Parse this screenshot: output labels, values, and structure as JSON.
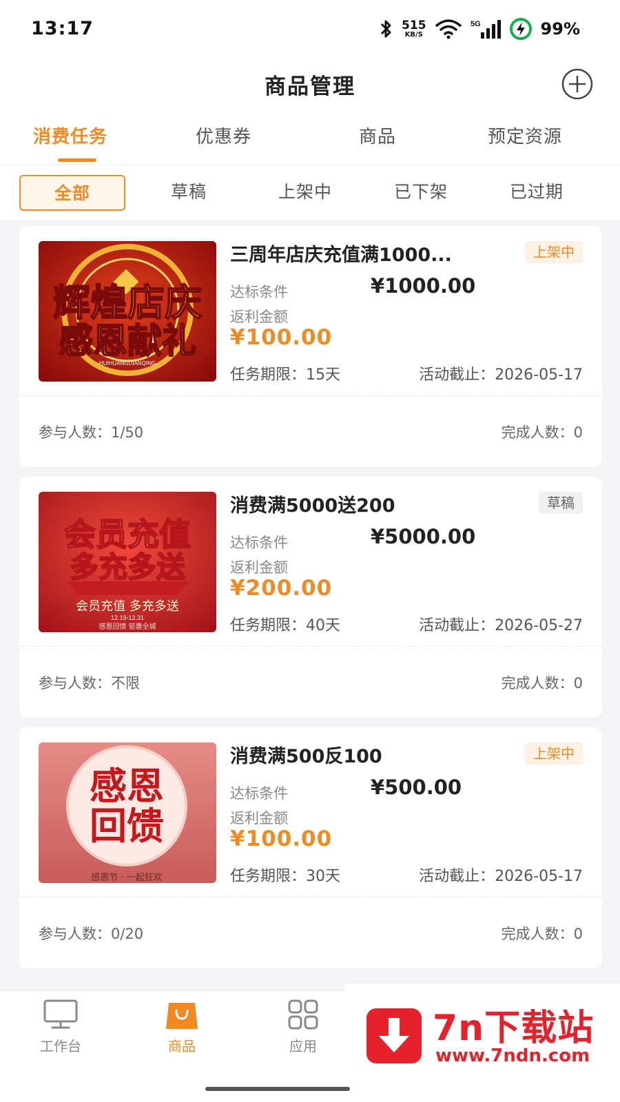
{
  "status_bar": {
    "time": "13:17",
    "net_speed": "515",
    "net_unit": "KB/S",
    "network": "5G",
    "battery": "99%",
    "icons": [
      "bluetooth-icon",
      "wifi-icon",
      "signal-icon",
      "battery-charging-icon"
    ]
  },
  "header": {
    "title": "商品管理",
    "add_icon": "plus-circle-icon"
  },
  "main_tabs": [
    {
      "label": "消费任务",
      "active": true
    },
    {
      "label": "优惠券",
      "active": false
    },
    {
      "label": "商品",
      "active": false
    },
    {
      "label": "预定资源",
      "active": false
    }
  ],
  "filters": [
    {
      "label": "全部",
      "active": true
    },
    {
      "label": "草稿",
      "active": false
    },
    {
      "label": "上架中",
      "active": false
    },
    {
      "label": "已下架",
      "active": false
    },
    {
      "label": "已过期",
      "active": false
    }
  ],
  "cards": [
    {
      "title": "三周年店庆充值满1000...",
      "status": "上架中",
      "cond_label": "达标条件",
      "cond_value": "¥1000.00",
      "rebate_label": "返利金额",
      "rebate_value": "¥100.00",
      "period": "任务期限：15天",
      "deadline": "活动截止：2026-05-17",
      "participants": "参与人数：1/50",
      "completed": "完成人数：0",
      "image": {
        "line1": "辉煌店庆",
        "line2": "感恩献礼",
        "caption": "HUIHUANGDIANQING"
      }
    },
    {
      "title": "消费满5000送200",
      "status": "草稿",
      "cond_label": "达标条件",
      "cond_value": "¥5000.00",
      "rebate_label": "返利金额",
      "rebate_value": "¥200.00",
      "period": "任务期限：40天",
      "deadline": "活动截止：2026-05-27",
      "participants": "参与人数：不限",
      "completed": "完成人数：0",
      "image": {
        "line1": "会员充值",
        "line2": "多充多送",
        "caption": "会员充值 多充多送",
        "date": "12.19-12.31",
        "footer": "感恩回馈 钜惠全城"
      }
    },
    {
      "title": "消费满500反100",
      "status": "上架中",
      "cond_label": "达标条件",
      "cond_value": "¥500.00",
      "rebate_label": "返利金额",
      "rebate_value": "¥100.00",
      "period": "任务期限：30天",
      "deadline": "活动截止：2026-05-17",
      "participants": "参与人数：0/20",
      "completed": "完成人数：0",
      "image": {
        "line1": "感恩",
        "line2": "回馈",
        "caption": "感恩节 · 一起狂欢"
      }
    }
  ],
  "bottom_nav": [
    {
      "label": "工作台",
      "icon": "monitor-icon",
      "active": false
    },
    {
      "label": "商品",
      "icon": "shopping-bag-icon",
      "active": true
    },
    {
      "label": "应用",
      "icon": "grid-icon",
      "active": false
    }
  ],
  "watermark": {
    "title": "7n下载站",
    "url": "www.7ndn.com"
  },
  "colors": {
    "accent": "#f08a24",
    "badge_orange_bg": "#fff1e3",
    "badge_gray_bg": "#f0f1f3",
    "watermark_red": "#e5222b"
  }
}
